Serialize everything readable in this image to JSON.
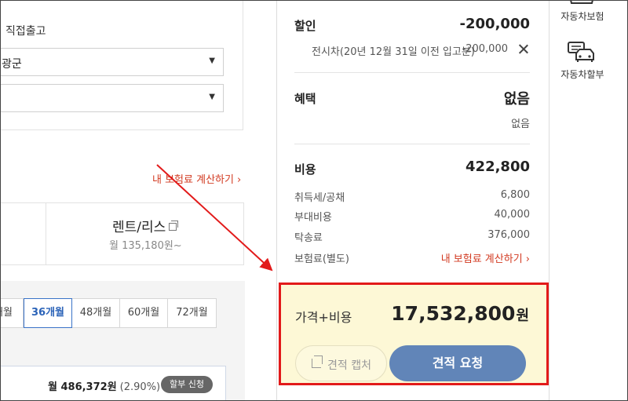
{
  "left": {
    "delivery_label": "직접출고",
    "select1_value": "광군",
    "select2_value": "",
    "insurance_link": "내 보험료 계산하기",
    "rent_title": "렌트/리스",
    "rent_sub": "월 135,180원~",
    "tabs": [
      {
        "label": "개월",
        "active": false
      },
      {
        "label": "36개월",
        "active": true
      },
      {
        "label": "48개월",
        "active": false
      },
      {
        "label": "60개월",
        "active": false
      },
      {
        "label": "72개월",
        "active": false
      }
    ],
    "installment": {
      "amount": "월 486,372원",
      "rate": "(2.90%)",
      "button": "할부 신청"
    }
  },
  "summary": {
    "discount": {
      "title": "할인",
      "value": "-200,000",
      "detail_label": "전시차(20년 12월 31일 이전 입고분)",
      "detail_value": "-200,000"
    },
    "benefit": {
      "title": "혜택",
      "value": "없음",
      "detail": "없음"
    },
    "cost": {
      "title": "비용",
      "value": "422,800",
      "rows": [
        {
          "label": "취득세/공채",
          "value": "6,800"
        },
        {
          "label": "부대비용",
          "value": "40,000"
        },
        {
          "label": "탁송료",
          "value": "376,000"
        },
        {
          "label": "보험료(별도)",
          "value": "내 보험료 계산하기"
        }
      ]
    },
    "total": {
      "label": "가격+비용",
      "value": "17,532,800",
      "unit": "원"
    },
    "capture_button": "견적 캡처",
    "request_button": "견적 요청"
  },
  "rail": {
    "items": [
      {
        "label": "자동차보험",
        "icon": "car-insurance-icon"
      },
      {
        "label": "자동차할부",
        "icon": "car-installment-icon"
      }
    ]
  },
  "colors": {
    "accent_blue": "#6185b8",
    "link_red": "#d23a21",
    "highlight_red": "#e21a1a",
    "total_bg": "#fdf8d6",
    "active_tab": "#3a73c8"
  }
}
